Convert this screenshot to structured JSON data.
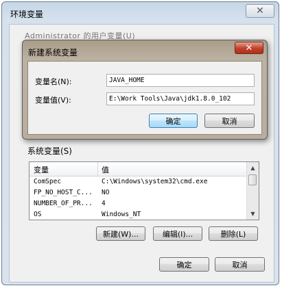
{
  "env_dialog": {
    "title": "环境变量",
    "close_glyph": "✕",
    "user_vars_label": "Administrator 的用户变量(U)",
    "system_vars_label": "系统变量(S)",
    "columns": [
      "变量",
      "值"
    ],
    "rows": [
      {
        "name": "ComSpec",
        "value": "C:\\Windows\\system32\\cmd.exe"
      },
      {
        "name": "FP_NO_HOST_C...",
        "value": "NO"
      },
      {
        "name": "NUMBER_OF_PR...",
        "value": "4"
      },
      {
        "name": "OS",
        "value": "Windows_NT"
      }
    ],
    "new_button": "新建(W)...",
    "edit_button": "编辑(I)...",
    "delete_button": "删除(L)",
    "ok_button": "确定",
    "cancel_button": "取消"
  },
  "new_var_dialog": {
    "title": "新建系统变量",
    "close_glyph": "✕",
    "name_label": "变量名(N):",
    "name_value": "JAVA_HOME",
    "value_label": "变量值(V):",
    "value_value": "E:\\Work Tools\\Java\\jdk1.8.0_102",
    "ok_button": "确定",
    "cancel_button": "取消"
  }
}
